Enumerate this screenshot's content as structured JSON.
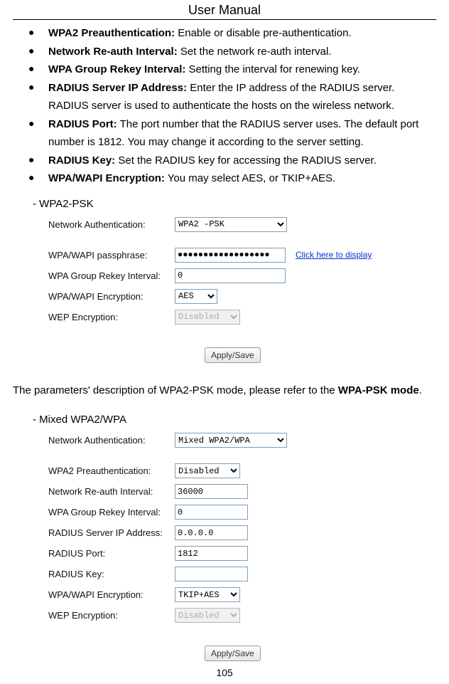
{
  "header": {
    "title": "User Manual"
  },
  "bullets": [
    {
      "term": "WPA2 Preauthentication:",
      "desc": " Enable or disable pre-authentication."
    },
    {
      "term": "Network Re-auth Interval:",
      "desc": " Set the network re-auth interval."
    },
    {
      "term": "WPA Group Rekey Interval:",
      "desc": " Setting the interval for renewing key."
    },
    {
      "term": "RADIUS Server IP Address:",
      "desc": " Enter the IP address of the RADIUS server. RADIUS server is used to authenticate the hosts on the wireless network."
    },
    {
      "term": "RADIUS Port:",
      "desc": " The port number that the RADIUS server uses. The default port number is 1812. You may change it according to the server setting."
    },
    {
      "term": "RADIUS Key:",
      "desc": " Set the RADIUS key for accessing the RADIUS server."
    },
    {
      "term": "WPA/WAPI Encryption:",
      "desc": " You may select AES, or TKIP+AES."
    }
  ],
  "section1": {
    "heading": "-  WPA2-PSK",
    "rows": {
      "net_auth": {
        "label": "Network Authentication:",
        "value": "WPA2 -PSK"
      },
      "passphrase": {
        "label": "WPA/WAPI passphrase:",
        "value": "●●●●●●●●●●●●●●●●●●",
        "link": "Click here to display"
      },
      "rekey": {
        "label": "WPA Group Rekey Interval:",
        "value": "0"
      },
      "enc": {
        "label": "WPA/WAPI Encryption:",
        "value": "AES"
      },
      "wep": {
        "label": "WEP Encryption:",
        "value": "Disabled"
      }
    },
    "button": "Apply/Save"
  },
  "para": {
    "pre": "The parameters' description of WPA2-PSK mode, please refer to the ",
    "bold": "WPA-PSK mode",
    "post": "."
  },
  "section2": {
    "heading": "-  Mixed WPA2/WPA",
    "rows": {
      "net_auth": {
        "label": "Network Authentication:",
        "value": "Mixed WPA2/WPA"
      },
      "preauth": {
        "label": "WPA2 Preauthentication:",
        "value": "Disabled"
      },
      "reauth": {
        "label": "Network Re-auth Interval:",
        "value": "36000"
      },
      "rekey": {
        "label": "WPA Group Rekey Interval:",
        "value": "0"
      },
      "radius_ip": {
        "label": "RADIUS Server IP Address:",
        "value": "0.0.0.0"
      },
      "radius_port": {
        "label": "RADIUS Port:",
        "value": "1812"
      },
      "radius_key": {
        "label": "RADIUS Key:",
        "value": ""
      },
      "enc": {
        "label": "WPA/WAPI Encryption:",
        "value": "TKIP+AES"
      },
      "wep": {
        "label": "WEP Encryption:",
        "value": "Disabled"
      }
    },
    "button": "Apply/Save"
  },
  "page_number": "105"
}
